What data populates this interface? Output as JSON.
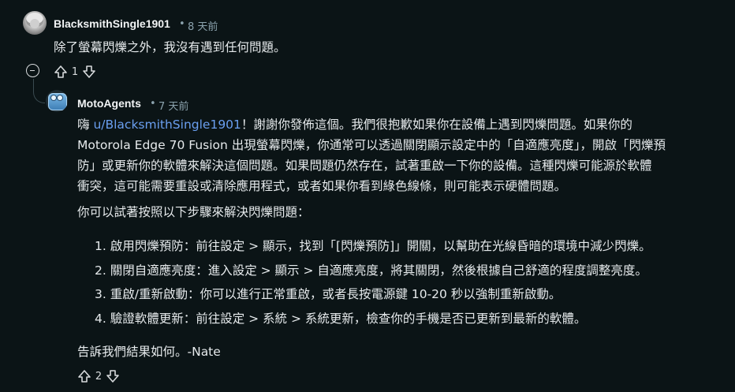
{
  "comment1": {
    "username": "BlacksmithSingle1901",
    "separator": "•",
    "time": "8 天前",
    "body": "除了螢幕閃爍之外，我沒有遇到任何問題。",
    "votes": "1"
  },
  "comment2": {
    "username": "MotoAgents",
    "separator": "•",
    "time": "7 天前",
    "greeting": "嗨 ",
    "mention": "u/BlacksmithSingle1901",
    "line1_rest": "！謝謝你發佈這個。我們很抱歉如果你在設備上遇到閃爍問題。如果你的",
    "line2": "Motorola Edge 70 Fusion 出現螢幕閃爍，你通常可以透過關閉顯示設定中的「自適應亮度」，開啟「閃爍預",
    "line3": "防」或更新你的軟體來解決這個問題。如果問題仍然存在，試著重啟一下你的設備。這種閃爍可能源於軟體",
    "line4": "衝突，這可能需要重設或清除應用程式，或者如果你看到綠色線條，則可能表示硬體問題。",
    "intro": "你可以試著按照以下步驟來解決閃爍問題：",
    "steps": [
      "1. 啟用閃爍預防：前往設定 > 顯示，找到「[閃爍預防]」開關，以幫助在光線昏暗的環境中減少閃爍。",
      "2. 關閉自適應亮度：進入設定 > 顯示 > 自適應亮度，將其關閉，然後根據自己舒適的程度調整亮度。",
      "3. 重啟/重新啟動：你可以進行正常重啟，或者長按電源鍵 10-20 秒以強制重新啟動。",
      "4. 驗證軟體更新：前往設定 > 系統 > 系統更新，檢查你的手機是否已更新到最新的軟體。"
    ],
    "closing": "告訴我們結果如何。-Nate",
    "votes": "2"
  },
  "colors": {
    "background": "#0b1416",
    "text": "#e6eaec",
    "meta": "#8ba2ad",
    "link": "#6a9ff0",
    "thread_line": "#3a4a50"
  },
  "icons": {
    "upvote": "arrow-up-icon",
    "downvote": "arrow-down-icon",
    "collapse": "minus-circle-icon"
  }
}
